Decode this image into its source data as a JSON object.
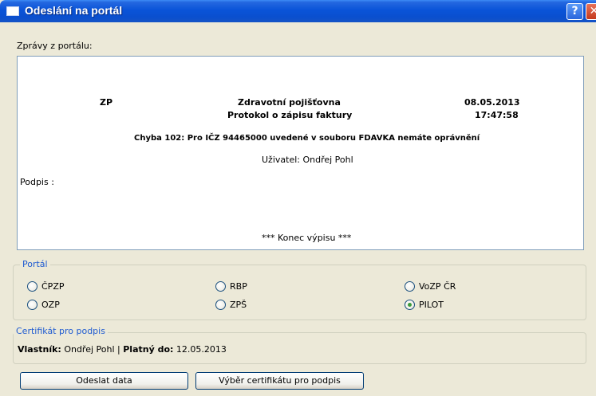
{
  "window": {
    "title": "Odeslání na portál",
    "help_label": "?",
    "close_label": "✕"
  },
  "messages": {
    "label": "Zprávy z portálu:",
    "left_code": "ZP",
    "center_title": "Zdravotní pojišťovna",
    "center_subtitle": "Protokol o zápisu faktury",
    "date": "08.05.2013",
    "time": "17:47:58",
    "error": "Chyba 102:  Pro IČZ 94465000 uvedené v souboru FDAVKA nemáte oprávnění",
    "user": "Uživatel: Ondřej Pohl",
    "signature": "Podpis :",
    "end": "*** Konec výpisu ***"
  },
  "portal": {
    "legend": "Portál",
    "options": [
      {
        "label": "ČPZP",
        "checked": false
      },
      {
        "label": "RBP",
        "checked": false
      },
      {
        "label": "VoZP ČR",
        "checked": false
      },
      {
        "label": "OZP",
        "checked": false
      },
      {
        "label": "ZPŠ",
        "checked": false
      },
      {
        "label": "PILOT",
        "checked": true
      }
    ]
  },
  "certificate": {
    "legend": "Certifikát pro podpis",
    "owner_label": "Vlastník:",
    "owner_value": " Ondřej Pohl | ",
    "valid_label": "Platný do:",
    "valid_value": " 12.05.2013"
  },
  "buttons": {
    "send": "Odeslat data",
    "choose_cert": "Výběr certifikátu pro podpis"
  }
}
